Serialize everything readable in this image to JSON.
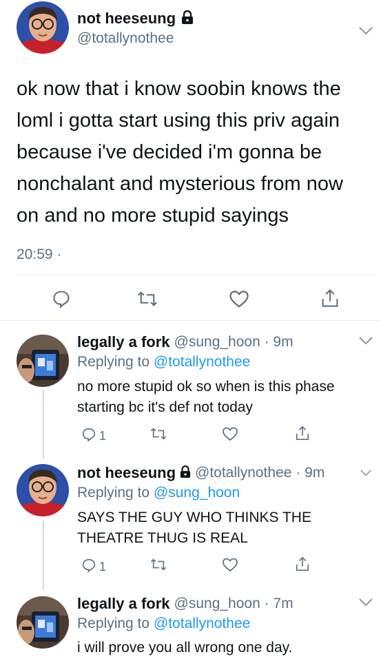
{
  "main_tweet": {
    "display_name": "not heeseung",
    "handle": "@totallynothee",
    "text_lines": [
      "ok now that i know soobin knows the",
      "loml i gotta start using this priv again",
      "because i've decided i'm gonna be",
      "nonchalant and mysterious from now",
      "on and no more stupid sayings"
    ],
    "time": "20:59 ·",
    "lock_icon": "lock-icon"
  },
  "replies": [
    {
      "display_name": "legally a fork",
      "meta": "@sung_hoon · 9m",
      "replying_label": "Replying to",
      "replying_to": "@totallynothee",
      "text_lines": [
        "no more stupid ok so when is this phase",
        "starting bc it's def not today"
      ],
      "reply_count": "1",
      "locked": false
    },
    {
      "display_name": "not heeseung",
      "meta": "@totallynothee · 9m",
      "replying_label": "Replying to",
      "replying_to": "@sung_hoon",
      "text_lines": [
        "SAYS THE GUY WHO THINKS THE",
        "THEATRE THUG IS REAL"
      ],
      "reply_count": "1",
      "locked": true
    },
    {
      "display_name": "legally a fork",
      "meta": "@sung_hoon · 7m",
      "replying_label": "Replying to",
      "replying_to": "@totallynothee",
      "text_lines": [
        "i will prove you all wrong one day."
      ],
      "locked": false
    }
  ],
  "colors": {
    "link": "#1d9bf0",
    "muted": "#5b7083",
    "text": "#0f1419"
  }
}
